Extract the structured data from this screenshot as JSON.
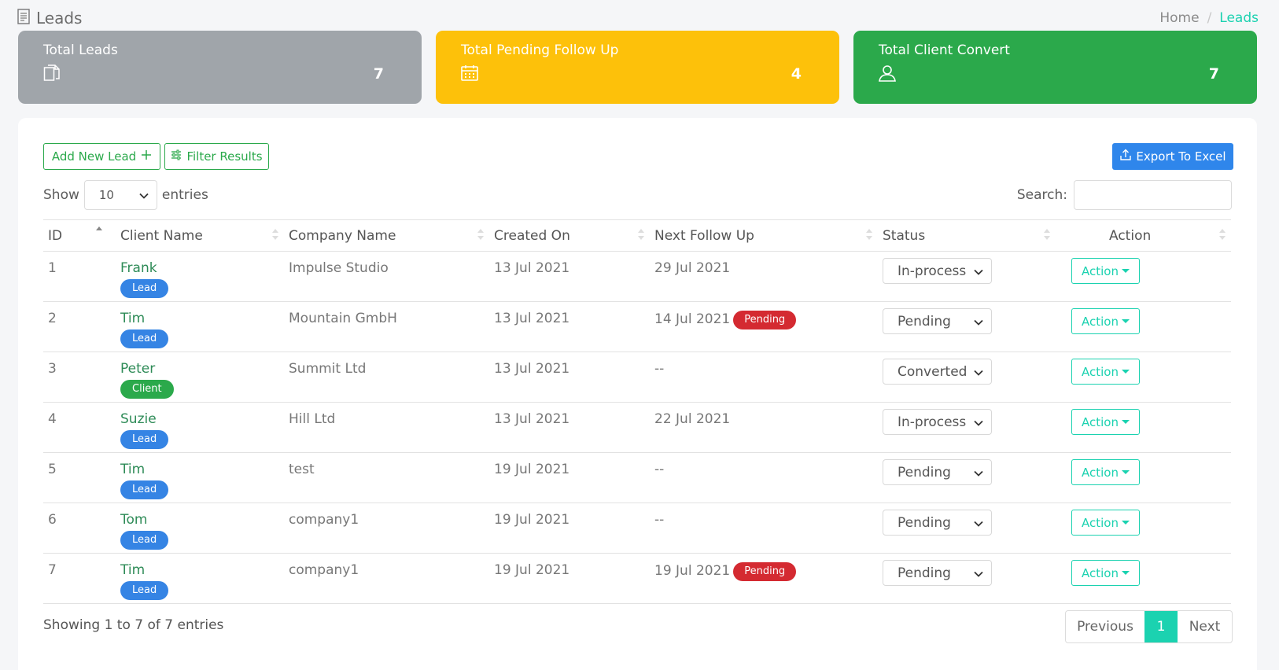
{
  "header": {
    "title": "Leads",
    "breadcrumb_home": "Home",
    "breadcrumb_sep": "/",
    "breadcrumb_current": "Leads"
  },
  "cards": {
    "total_leads": {
      "label": "Total Leads",
      "value": "7",
      "icon": "documents-icon",
      "color": "#a0a5aa"
    },
    "pending": {
      "label": "Total Pending Follow Up",
      "value": "4",
      "icon": "calendar-icon",
      "color": "#fdc10a"
    },
    "converted": {
      "label": "Total Client Convert",
      "value": "7",
      "icon": "user-icon",
      "color": "#2ba94b"
    }
  },
  "toolbar": {
    "add_label": "Add New Lead",
    "filter_label": "Filter Results",
    "export_label": "Export To Excel"
  },
  "length": {
    "show": "Show",
    "value": "10",
    "entries": "entries"
  },
  "search": {
    "label": "Search:",
    "value": ""
  },
  "columns": [
    "ID",
    "Client Name",
    "Company Name",
    "Created On",
    "Next Follow Up",
    "Status",
    "Action"
  ],
  "rows": [
    {
      "id": "1",
      "client": "Frank",
      "type": "Lead",
      "company": "Impulse Studio",
      "created": "13 Jul 2021",
      "follow": "29 Jul 2021",
      "pending": "",
      "status": "In-process",
      "action": "Action"
    },
    {
      "id": "2",
      "client": "Tim",
      "type": "Lead",
      "company": "Mountain GmbH",
      "created": "13 Jul 2021",
      "follow": "14 Jul 2021",
      "pending": "Pending",
      "status": "Pending",
      "action": "Action"
    },
    {
      "id": "3",
      "client": "Peter",
      "type": "Client",
      "company": "Summit Ltd",
      "created": "13 Jul 2021",
      "follow": "--",
      "pending": "",
      "status": "Converted",
      "action": "Action"
    },
    {
      "id": "4",
      "client": "Suzie",
      "type": "Lead",
      "company": "Hill Ltd",
      "created": "13 Jul 2021",
      "follow": "22 Jul 2021",
      "pending": "",
      "status": "In-process",
      "action": "Action"
    },
    {
      "id": "5",
      "client": "Tim",
      "type": "Lead",
      "company": "test",
      "created": "19 Jul 2021",
      "follow": "--",
      "pending": "",
      "status": "Pending",
      "action": "Action"
    },
    {
      "id": "6",
      "client": "Tom",
      "type": "Lead",
      "company": "company1",
      "created": "19 Jul 2021",
      "follow": "--",
      "pending": "",
      "status": "Pending",
      "action": "Action"
    },
    {
      "id": "7",
      "client": "Tim",
      "type": "Lead",
      "company": "company1",
      "created": "19 Jul 2021",
      "follow": "19 Jul 2021",
      "pending": "Pending",
      "status": "Pending",
      "action": "Action"
    }
  ],
  "footer": {
    "info": "Showing 1 to 7 of 7 entries",
    "prev": "Previous",
    "page": "1",
    "next": "Next"
  },
  "colors": {
    "accent": "#1bd2b0",
    "primary": "#2f86eb",
    "success": "#2ba94b",
    "warning": "#fdc10a",
    "danger": "#d42a31"
  }
}
